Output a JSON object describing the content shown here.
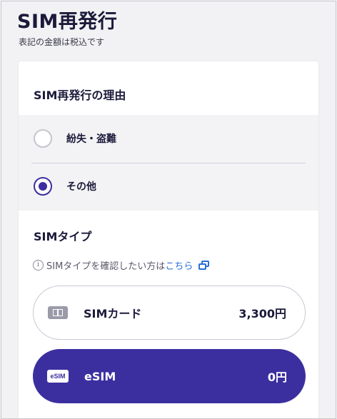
{
  "page": {
    "title": "SIM再発行",
    "note": "表記の金額は税込です"
  },
  "reason": {
    "title": "SIM再発行の理由",
    "options": [
      {
        "label": "紛失・盗難",
        "selected": false
      },
      {
        "label": "その他",
        "selected": true
      }
    ]
  },
  "sim_type": {
    "title": "SIMタイプ",
    "info_icon": "i",
    "info_text": "SIMタイプを確認したい方は",
    "info_link": "こちら",
    "options": [
      {
        "name": "SIMカード",
        "price": "3,300円",
        "icon": "sim-card-icon",
        "selected": false
      },
      {
        "name": "eSIM",
        "price": "0円",
        "icon": "esim-icon",
        "icon_text": "eSIM",
        "selected": true
      }
    ]
  },
  "colors": {
    "accent": "#3b2fa0",
    "link": "#2a6fd6",
    "background": "#f2f2f4"
  }
}
